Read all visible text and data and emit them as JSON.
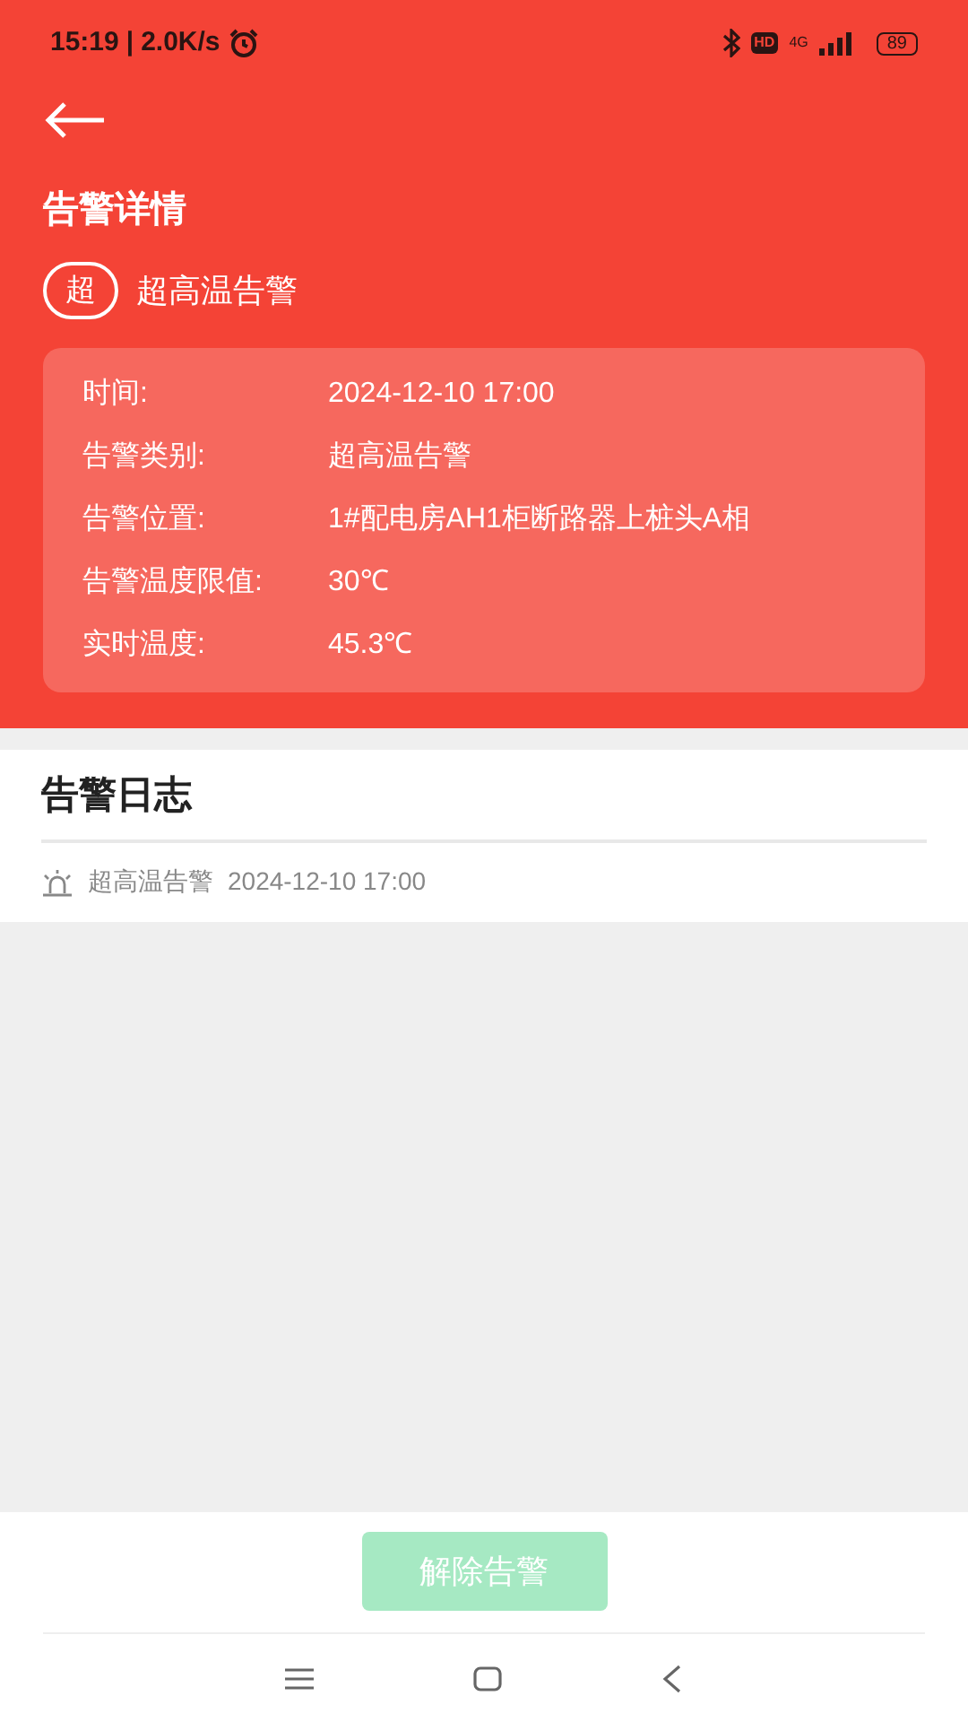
{
  "status_bar": {
    "time": "15:19",
    "separator": "|",
    "speed": "2.0K/s",
    "network": "4G",
    "battery": "89",
    "hd": "HD"
  },
  "header": {
    "title": "告警详情",
    "badge": "超",
    "alarm_name": "超高温告警"
  },
  "details": [
    {
      "label": "时间:",
      "value": "2024-12-10 17:00"
    },
    {
      "label": "告警类别:",
      "value": "超高温告警"
    },
    {
      "label": "告警位置:",
      "value": "1#配电房AH1柜断路器上桩头A相"
    },
    {
      "label": "告警温度限值:",
      "value": "30℃"
    },
    {
      "label": "实时温度:",
      "value": "45.3℃"
    }
  ],
  "log": {
    "title": "告警日志",
    "entries": [
      {
        "name": "超高温告警",
        "time": "2024-12-10 17:00"
      }
    ]
  },
  "action_button": {
    "label": "解除告警",
    "disabled": true
  }
}
